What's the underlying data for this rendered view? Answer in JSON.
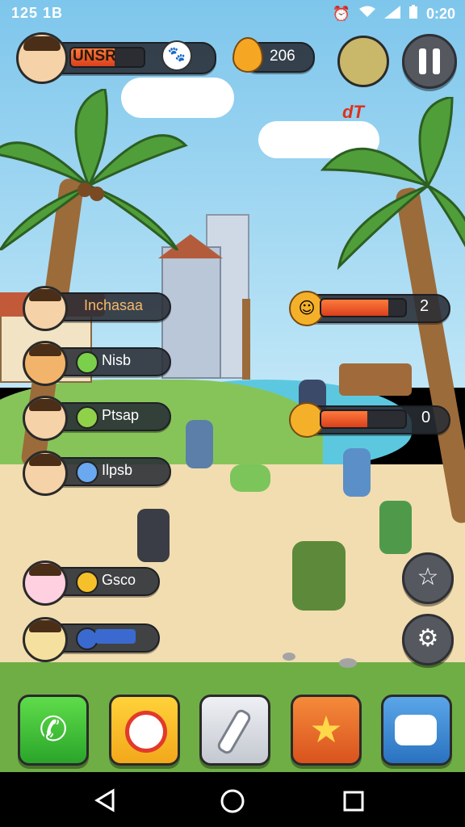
{
  "status_bar": {
    "time_left": "125 1B",
    "time_right": "0:20"
  },
  "hud": {
    "player_name": "UNSR",
    "player_health": 0.6,
    "coins": "206",
    "floating_text": "dT"
  },
  "party": [
    {
      "name": "Inchasaa"
    },
    {
      "name": "Nisb"
    },
    {
      "name": "Ptsap"
    },
    {
      "name": "Ilpsb"
    },
    {
      "name": "Gsco"
    },
    {
      "name": ""
    }
  ],
  "enemy_bars": [
    {
      "value": "2",
      "fill": 0.8
    },
    {
      "value": "0",
      "fill": 0.55
    }
  ],
  "colors": {
    "sky": "#9fd6f2",
    "sea": "#5cc8e0",
    "sand": "#f2ddb0",
    "grass": "#86c45a",
    "accent_orange": "#f0662a"
  },
  "dock": [
    {
      "icon": "phone-icon"
    },
    {
      "icon": "camera-icon"
    },
    {
      "icon": "bone-icon"
    },
    {
      "icon": "star-icon"
    },
    {
      "icon": "chat-icon"
    }
  ]
}
